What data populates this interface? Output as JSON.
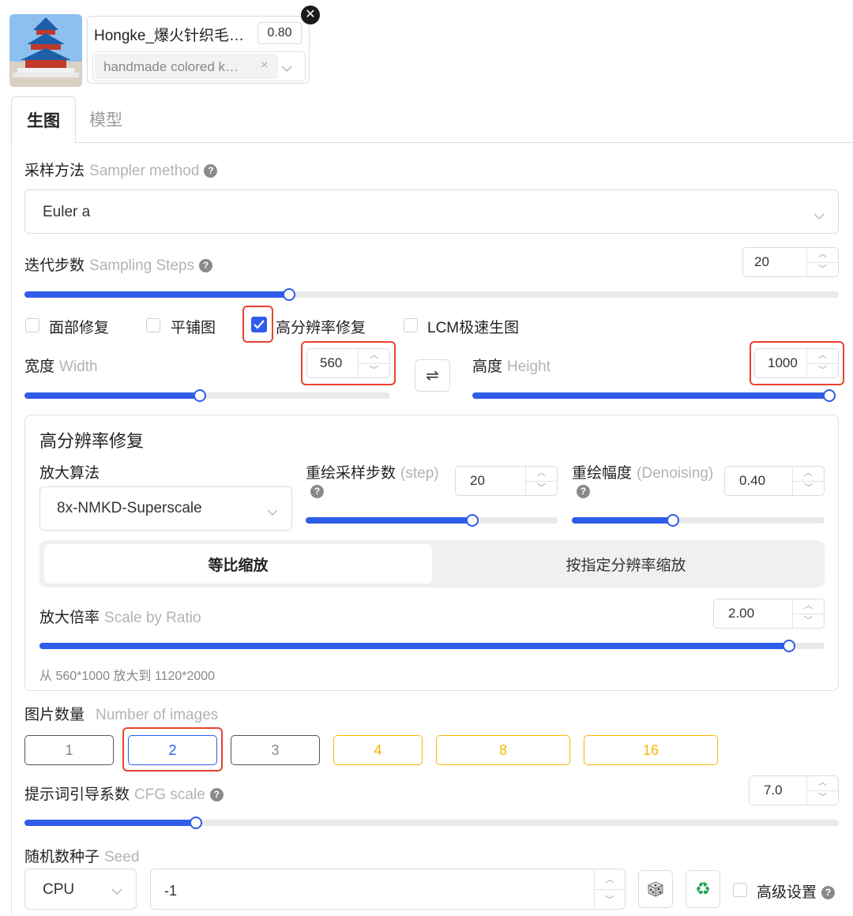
{
  "lora": {
    "name": "Hongke_爆火针织毛…",
    "weight": "0.80",
    "trigger_tag": "handmade colored k…",
    "tag_remove": "×",
    "dropdown_icon": "chevron-down-icon",
    "close_icon": "close-icon"
  },
  "tabs": [
    {
      "label": "生图",
      "active": true
    },
    {
      "label": "模型",
      "active": false
    }
  ],
  "sampler": {
    "label": "采样方法",
    "label_en": "Sampler method",
    "value": "Euler a"
  },
  "steps": {
    "label": "迭代步数",
    "label_en": "Sampling Steps",
    "value": "20",
    "slider_fraction": 0.325
  },
  "options": [
    {
      "label": "面部修复",
      "checked": false
    },
    {
      "label": "平铺图",
      "checked": false
    },
    {
      "label": "高分辨率修复",
      "checked": true
    },
    {
      "label": "LCM极速生图",
      "checked": false
    }
  ],
  "width": {
    "label": "宽度",
    "label_en": "Width",
    "value": "560",
    "slider_fraction": 0.48
  },
  "height": {
    "label": "高度",
    "label_en": "Height",
    "value": "1000",
    "slider_fraction": 1.0
  },
  "swap_icon": "⇌",
  "hires": {
    "title": "高分辨率修复",
    "upscaler": {
      "label": "放大算法",
      "value": "8x-NMKD-Superscale"
    },
    "steps": {
      "label": "重绘采样步数",
      "label_en": "(step)",
      "value": "20",
      "slider_fraction": 0.66
    },
    "denoise": {
      "label": "重绘幅度",
      "label_en": "(Denoising)",
      "value": "0.40",
      "slider_fraction": 0.4
    },
    "modes": [
      {
        "label": "等比缩放",
        "active": true
      },
      {
        "label": "按指定分辨率缩放",
        "active": false
      }
    ],
    "scale": {
      "label": "放大倍率",
      "label_en": "Scale by Ratio",
      "value": "2.00",
      "slider_fraction": 0.955
    },
    "note": "从 560*1000 放大到 1120*2000"
  },
  "num_images": {
    "label": "图片数量",
    "label_en": "Number of images",
    "options": [
      "1",
      "2",
      "3",
      "4",
      "8",
      "16"
    ],
    "selected": "2"
  },
  "cfg": {
    "label": "提示词引导系数",
    "label_en": "CFG scale",
    "value": "7.0",
    "slider_fraction": 0.21
  },
  "seed": {
    "label": "随机数种子",
    "label_en": "Seed",
    "device": "CPU",
    "value": "-1",
    "dice_icon": "dice-icon",
    "recycle_icon": "recycle-icon",
    "advanced_label": "高级设置"
  },
  "colors": {
    "accent": "#2f5ce8",
    "highlight": "#e8432f",
    "gold": "#f5b800"
  }
}
